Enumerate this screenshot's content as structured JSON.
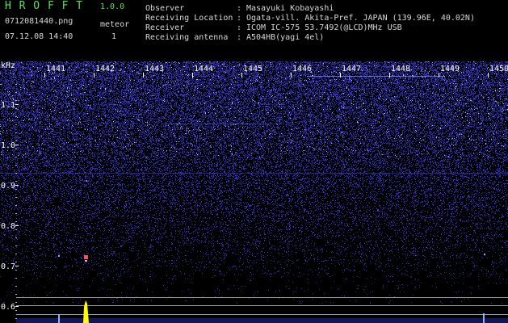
{
  "app": {
    "name": "H R O F F T",
    "version": "1.0.0",
    "filename": "0712081440.png",
    "datetime": "07.12.08 14:40",
    "meteor_label": "meteor",
    "meteor_count": "1"
  },
  "info": {
    "labels": [
      "Observer",
      "Receiving Location",
      "Receiver",
      "Receiving antenna"
    ],
    "values": [
      "Masayuki Kobayashi",
      "Ogata-vill. Akita-Pref. JAPAN (139.96E, 40.02N)",
      "ICOM IC-575 53.7492(@LCD)MHz USB",
      "A504HB(yagi 4el)"
    ]
  },
  "spectrogram": {
    "y_unit": "kHz",
    "y_ticks": [
      "1.1",
      "1.0",
      "0.9",
      "0.8",
      "0.7",
      "0.6"
    ],
    "time_ticks": [
      "1441",
      "1442",
      "1443",
      "1444",
      "1445",
      "1446",
      "1447",
      "1448",
      "1449",
      "1450"
    ]
  },
  "colors": {
    "header_label": "#d8d8d8",
    "app_title": "#59e159",
    "axis_text": "#ffffff",
    "noise": "#3a3ad8",
    "meteor": "#ffff00",
    "echo_marker": "#ff5050",
    "ref_lines": "#9a9a9a"
  }
}
